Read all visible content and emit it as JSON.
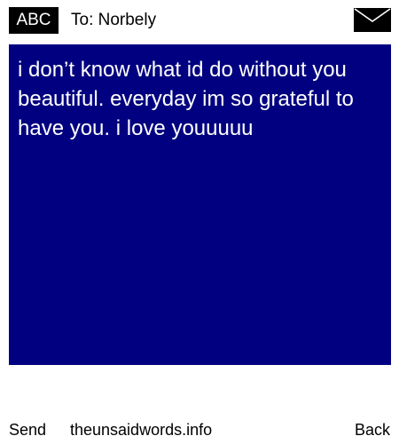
{
  "header": {
    "mode_label": "ABC",
    "recipient_line": "To: Norbely",
    "envelope_icon": "envelope-icon"
  },
  "message": {
    "text": "i don’t know what id do without you beautiful. everyday im so grateful to have you. i love youuuuu",
    "background_color": "#000080",
    "text_color": "#ffffff"
  },
  "footer": {
    "send_label": "Send",
    "site_label": "theunsaidwords.info",
    "back_label": "Back"
  }
}
